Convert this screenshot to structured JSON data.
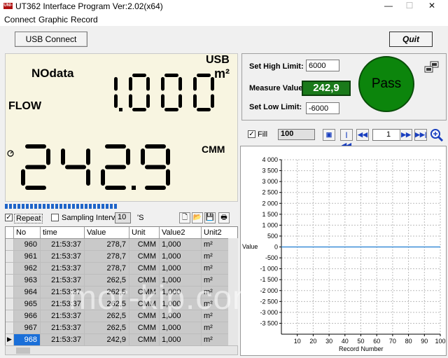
{
  "window": {
    "title": "UT362 Interface Program Ver:2.02(x64)",
    "app_icon_text": "UNI-T",
    "minimize_glyph": "—",
    "maximize_glyph": "☐",
    "close_glyph": "✕"
  },
  "menu": [
    "Connect",
    "Graphic",
    "Record"
  ],
  "top_buttons": {
    "usb_connect": "USB Connect",
    "quit": "Quit"
  },
  "lcd": {
    "nodata_label": "NOdata",
    "usb_label": "USB",
    "area_unit": "m²",
    "flow_label": "FLOW",
    "area_value": "1.000",
    "flow_value": "242.9",
    "flow_unit": "CMM",
    "segment_color": "#000000",
    "background_color": "#f8f5e1"
  },
  "progress": {
    "segments": 27,
    "color": "#1e64c8"
  },
  "record_toolbar": {
    "repeat_label": "Repeat",
    "repeat_checked": true,
    "sampling_label": "Sampling Interval",
    "sampling_checked": false,
    "sampling_value": "10",
    "sampling_unit": "'S",
    "icons": [
      "new-file-icon",
      "open-folder-icon",
      "save-icon",
      "print-icon"
    ]
  },
  "table": {
    "columns": [
      "No",
      "time",
      "Value",
      "Unit",
      "Value2",
      "Unit2"
    ],
    "rows": [
      [
        "960",
        "21:53:37",
        "278,7",
        "CMM",
        "1,000",
        "m²"
      ],
      [
        "961",
        "21:53:37",
        "278,7",
        "CMM",
        "1,000",
        "m²"
      ],
      [
        "962",
        "21:53:37",
        "278,7",
        "CMM",
        "1,000",
        "m²"
      ],
      [
        "963",
        "21:53:37",
        "262,5",
        "CMM",
        "1,000",
        "m²"
      ],
      [
        "964",
        "21:53:37",
        "262,5",
        "CMM",
        "1,000",
        "m²"
      ],
      [
        "965",
        "21:53:37",
        "262,5",
        "CMM",
        "1,000",
        "m²"
      ],
      [
        "966",
        "21:53:37",
        "262,5",
        "CMM",
        "1,000",
        "m²"
      ],
      [
        "967",
        "21:53:37",
        "262,5",
        "CMM",
        "1,000",
        "m²"
      ],
      [
        "968",
        "21:53:37",
        "242,9",
        "CMM",
        "1,000",
        "m²"
      ]
    ],
    "selected_row": 8,
    "row_pointer": "▶"
  },
  "limits": {
    "high_label": "Set High Limit:",
    "high_value": "6000",
    "measure_label": "Measure Value:",
    "measure_value": "242,9",
    "low_label": "Set Low Limit:",
    "low_value": "-6000",
    "status": "Pass",
    "status_color": "#0c850c"
  },
  "chart_toolbar": {
    "fill_label": "Fill",
    "fill_checked": true,
    "count_value": "100",
    "page_value": "1",
    "icons": [
      "save-icon",
      "first-page-icon",
      "prev-page-icon",
      "next-page-icon",
      "last-page-icon",
      "zoom-icon"
    ]
  },
  "chart_data": {
    "type": "line",
    "xlabel": "Record Number",
    "ylabel": "Value",
    "xlim": [
      0,
      100
    ],
    "ylim": [
      -3500,
      4000
    ],
    "x_ticks": [
      10,
      20,
      30,
      40,
      50,
      60,
      70,
      80,
      90,
      100
    ],
    "y_ticks": [
      "4 000",
      "3 500",
      "3 000",
      "2 500",
      "2 000",
      "1 500",
      "1 000",
      "500",
      "0",
      "-500",
      "-1 000",
      "-1 500",
      "-2 000",
      "-2 500",
      "-3 000",
      "-3 500"
    ],
    "y_tick_values": [
      4000,
      3500,
      3000,
      2500,
      2000,
      1500,
      1000,
      500,
      0,
      -500,
      -1000,
      -1500,
      -2000,
      -2500,
      -3000,
      -3500
    ],
    "series": [
      {
        "values": [
          0,
          0
        ],
        "x": [
          0,
          100
        ]
      }
    ],
    "line_color": "#3b8ed8",
    "grid": true
  },
  "watermark": "mor-kip.com"
}
